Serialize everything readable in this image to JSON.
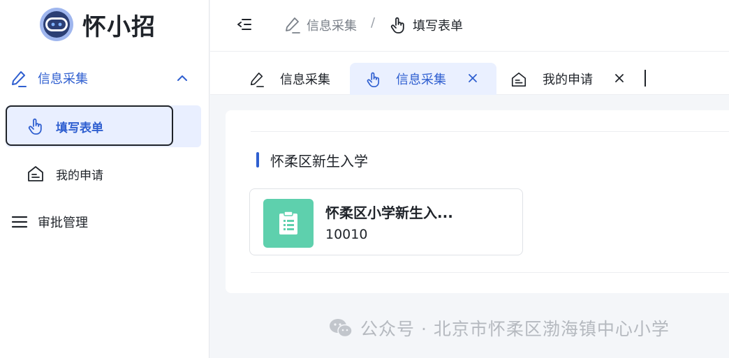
{
  "app": {
    "name": "怀小招"
  },
  "sidebar": {
    "group": {
      "label": "信息采集"
    },
    "items": [
      {
        "label": "填写表单",
        "active": true
      },
      {
        "label": "我的申请",
        "active": false
      }
    ],
    "approve": {
      "label": "审批管理"
    }
  },
  "header": {
    "breadcrumb": [
      {
        "label": "信息采集",
        "icon": "pencil-icon"
      },
      {
        "label": "填写表单",
        "icon": "pointer-hand-icon"
      }
    ],
    "separator": "/"
  },
  "tabs": [
    {
      "label": "信息采集",
      "icon": "pencil-icon",
      "closable": false,
      "active": false
    },
    {
      "label": "信息采集",
      "icon": "pointer-hand-icon",
      "closable": true,
      "active": true,
      "close_glyph": "×"
    },
    {
      "label": "我的申请",
      "icon": "house-doc-icon",
      "closable": true,
      "active": false,
      "close_glyph": "×"
    }
  ],
  "content": {
    "section_title": "怀柔区新生入学",
    "forms": [
      {
        "title": "怀柔区小学新生入...",
        "code": "10010",
        "icon": "clipboard-list-icon"
      }
    ]
  },
  "watermark": {
    "text": "公众号 · 北京市怀柔区渤海镇中心小学"
  },
  "colors": {
    "accent": "#2f5fd0",
    "active_bg": "#e9efff",
    "form_icon_bg": "#5ed0ad",
    "page_bg": "#f4f6f9"
  }
}
